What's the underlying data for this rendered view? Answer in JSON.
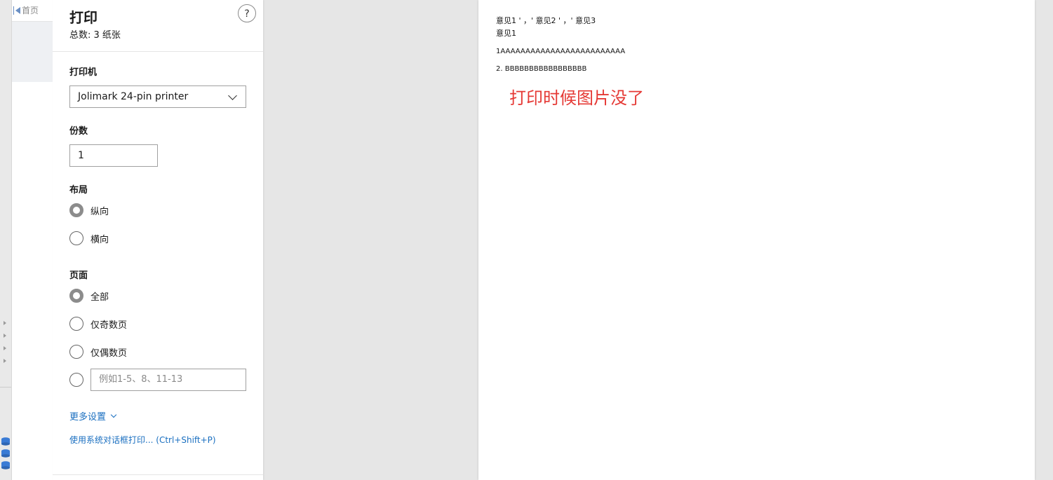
{
  "background_app": {
    "toolbar_first_label": "首页"
  },
  "dialog": {
    "title": "打印",
    "subtitle": "总数: 3 纸张",
    "help_label": "?",
    "printer": {
      "label": "打印机",
      "selected": "Jolimark 24-pin printer"
    },
    "copies": {
      "label": "份数",
      "value": "1"
    },
    "layout": {
      "label": "布局",
      "options": [
        {
          "label": "纵向",
          "checked": true
        },
        {
          "label": "横向",
          "checked": false
        }
      ]
    },
    "pages": {
      "label": "页面",
      "options": [
        {
          "label": "全部",
          "checked": true
        },
        {
          "label": "仅奇数页",
          "checked": false
        },
        {
          "label": "仅偶数页",
          "checked": false
        }
      ],
      "custom_placeholder": "例如1-5、8、11-13"
    },
    "more_settings": "更多设置",
    "system_dialog_link": "使用系统对话框打印... (Ctrl+Shift+P)"
  },
  "preview": {
    "lines": [
      "意见1 ' ，' 意见2 ' ，' 意见3",
      "意见1",
      "1AAAAAAAAAAAAAAAAAAAAAAAAA",
      "2. BBBBBBBBBBBBBBBBB"
    ],
    "annotation": "打印时候图片没了",
    "annotation_color": "#e53935"
  },
  "colors": {
    "link": "#1a6fc0",
    "radio_checked": "#8c8c8c"
  }
}
